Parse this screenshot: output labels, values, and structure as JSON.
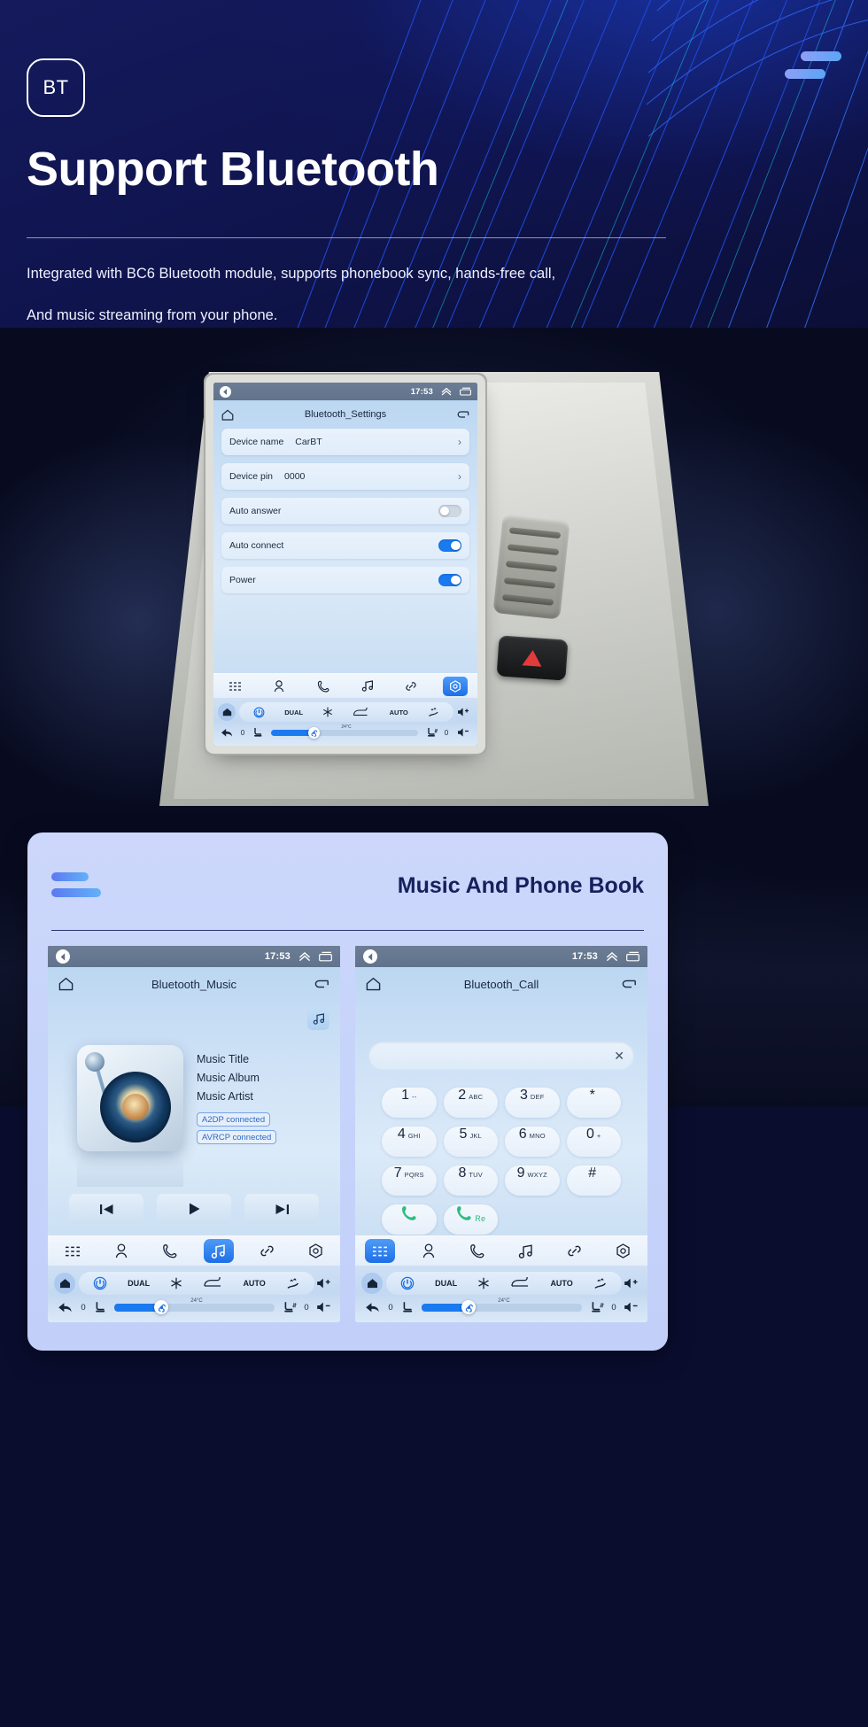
{
  "hero": {
    "badge": "BT",
    "title": "Support Bluetooth",
    "subtitle_line1": "Integrated with BC6 Bluetooth module, supports phonebook sync, hands-free call,",
    "subtitle_line2": "And music streaming from your phone.",
    "accent": "#5ba4f5",
    "bg": "#101550"
  },
  "main_screen": {
    "status": {
      "time": "17:53",
      "back_icon": "back-arrow-icon",
      "collapse_icon": "chevron-up-icon",
      "recents_icon": "recents-icon"
    },
    "app_title": "Bluetooth_Settings",
    "home_icon": "home-icon",
    "return_icon": "return-icon",
    "rows": [
      {
        "label": "Device name",
        "value": "CarBT",
        "control": "chevron",
        "on": false
      },
      {
        "label": "Device pin",
        "value": "0000",
        "control": "chevron",
        "on": false
      },
      {
        "label": "Auto answer",
        "value": "",
        "control": "toggle",
        "on": false
      },
      {
        "label": "Auto connect",
        "value": "",
        "control": "toggle",
        "on": true
      },
      {
        "label": "Power",
        "value": "",
        "control": "toggle",
        "on": true
      }
    ],
    "dock": [
      "apps-icon",
      "contacts-icon",
      "phone-icon",
      "music-icon",
      "link-icon",
      "settings-icon"
    ],
    "dock_selected": 5,
    "climate": {
      "power": "power-icon",
      "dual": "DUAL",
      "snow": "snowflake-icon",
      "recirc": "recirculate-icon",
      "auto": "AUTO",
      "defrost": "defrost-icon",
      "temp": "24°C",
      "vol_up": "volume-up-icon",
      "vol_down": "volume-down-icon",
      "left_num": "0",
      "right_num": "0",
      "fan_percent": 28
    }
  },
  "panel": {
    "title": "Music And Phone Book"
  },
  "music_screen": {
    "status": {
      "time": "17:53"
    },
    "app_title": "Bluetooth_Music",
    "note_button": "music-note-icon",
    "meta": {
      "title": "Music Title",
      "album": "Music Album",
      "artist": "Music Artist"
    },
    "badges": [
      "A2DP  connected",
      "AVRCP connected"
    ],
    "transport": [
      "previous-track-icon",
      "play-icon",
      "next-track-icon"
    ],
    "dock": [
      "apps-icon",
      "contacts-icon",
      "phone-icon",
      "music-icon",
      "link-icon",
      "settings-icon"
    ],
    "dock_selected": 3,
    "climate": {
      "dual": "DUAL",
      "auto": "AUTO",
      "temp": "24°C",
      "left_num": "0",
      "right_num": "0",
      "fan_percent": 28
    }
  },
  "call_screen": {
    "status": {
      "time": "17:53"
    },
    "app_title": "Bluetooth_Call",
    "input_value": "",
    "clear_icon": "clear-icon",
    "keys": [
      {
        "n": "1",
        "s": "--"
      },
      {
        "n": "2",
        "s": "ABC"
      },
      {
        "n": "3",
        "s": "DEF"
      },
      {
        "n": "*",
        "s": ""
      },
      {
        "n": "4",
        "s": "GHI"
      },
      {
        "n": "5",
        "s": "JKL"
      },
      {
        "n": "6",
        "s": "MNO"
      },
      {
        "n": "0",
        "s": "+"
      },
      {
        "n": "7",
        "s": "PQRS"
      },
      {
        "n": "8",
        "s": "TUV"
      },
      {
        "n": "9",
        "s": "WXYZ"
      },
      {
        "n": "#",
        "s": ""
      }
    ],
    "call_key": {
      "icon": "phone-call-icon",
      "label": ""
    },
    "redial_key": {
      "icon": "phone-call-icon",
      "label": "Re"
    },
    "dock": [
      "apps-icon",
      "contacts-icon",
      "phone-icon",
      "music-icon",
      "link-icon",
      "settings-icon"
    ],
    "dock_selected": 0,
    "climate": {
      "dual": "DUAL",
      "auto": "AUTO",
      "temp": "24°C",
      "left_num": "0",
      "right_num": "0",
      "fan_percent": 28
    }
  }
}
